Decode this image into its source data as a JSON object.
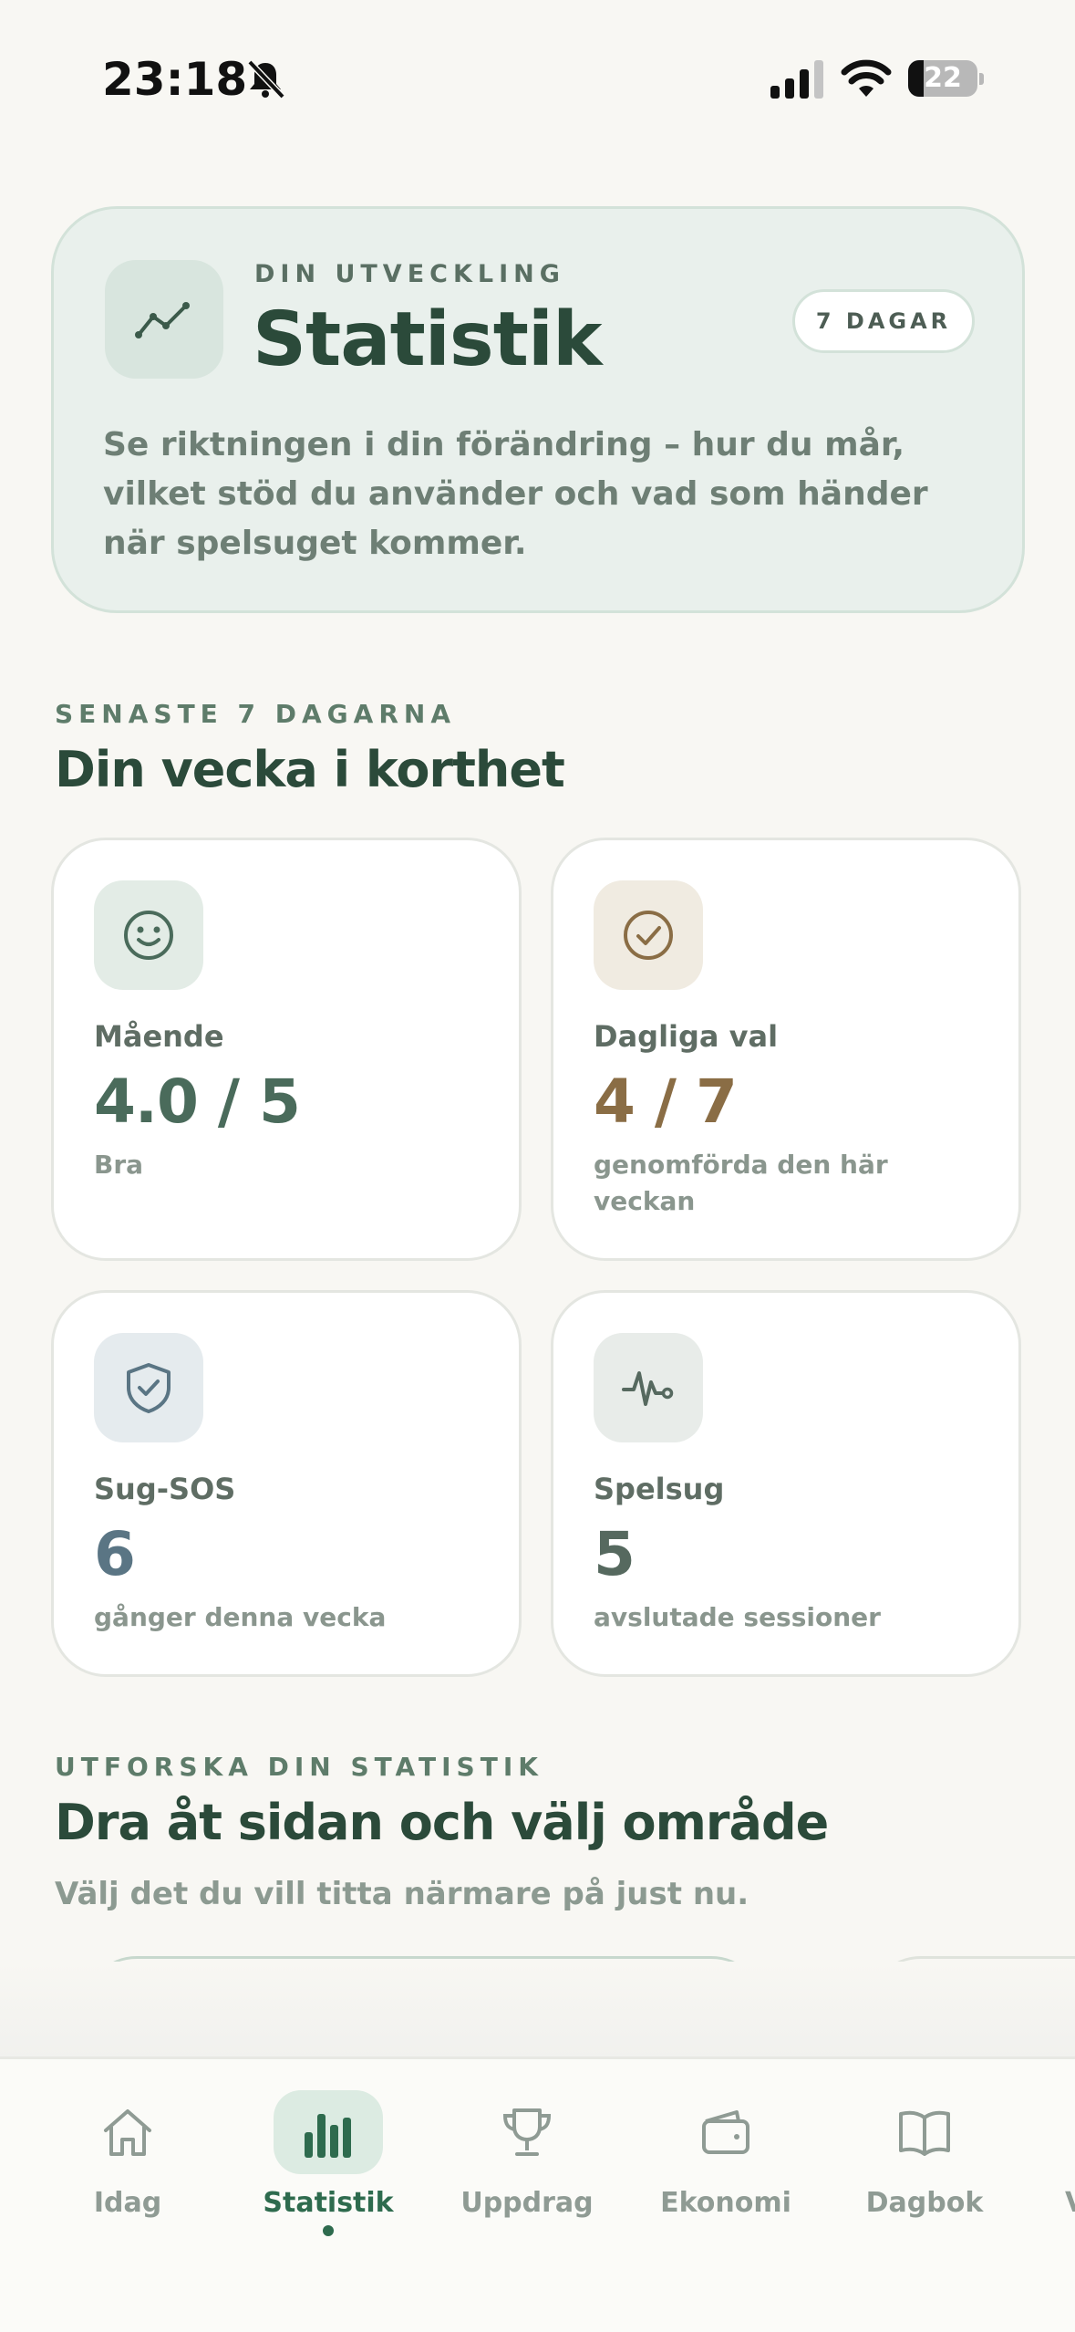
{
  "status_bar": {
    "time": "23:18",
    "battery": "22",
    "battery_level": 0.22
  },
  "hero": {
    "kicker": "DIN UTVECKLING",
    "title": "Statistik",
    "period_pill": "7 DAGAR",
    "description": "Se riktningen i din förändring – hur du mår, vilket stöd du använder och vad som händer när spelsuget kommer.",
    "icon": "trend-line-icon"
  },
  "week": {
    "kicker": "SENASTE 7 DAGARNA",
    "title": "Din vecka i korthet",
    "cards": [
      {
        "label": "Mående",
        "value": "4.0 / 5",
        "sub": "Bra",
        "icon": "smiley-icon",
        "accent": "#4a6b5b",
        "icon_bg": "#e3ece6"
      },
      {
        "label": "Dagliga val",
        "value": "4 / 7",
        "sub": "genomförda den här veckan",
        "icon": "check-circle-icon",
        "accent": "#8a6d45",
        "icon_bg": "#f0ebe1"
      },
      {
        "label": "Sug-SOS",
        "value": "6",
        "sub": "gånger denna vecka",
        "icon": "shield-check-icon",
        "accent": "#5a7584",
        "icon_bg": "#e5ebee"
      },
      {
        "label": "Spelsug",
        "value": "5",
        "sub": "avslutade sessioner",
        "icon": "pulse-icon",
        "accent": "#56695f",
        "icon_bg": "#e8ece9"
      }
    ]
  },
  "explore": {
    "kicker": "UTFORSKA DIN STATISTIK",
    "title": "Dra åt sidan och välj område",
    "subtitle": "Välj det du vill titta närmare på just nu."
  },
  "tabbar": {
    "tabs": [
      {
        "label": "Idag",
        "icon": "home-icon"
      },
      {
        "label": "Statistik",
        "icon": "bar-chart-icon",
        "active": true
      },
      {
        "label": "Uppdrag",
        "icon": "trophy-icon"
      },
      {
        "label": "Ekonomi",
        "icon": "wallet-icon"
      },
      {
        "label": "Dagbok",
        "icon": "book-icon"
      }
    ],
    "clipped_label": "V"
  }
}
